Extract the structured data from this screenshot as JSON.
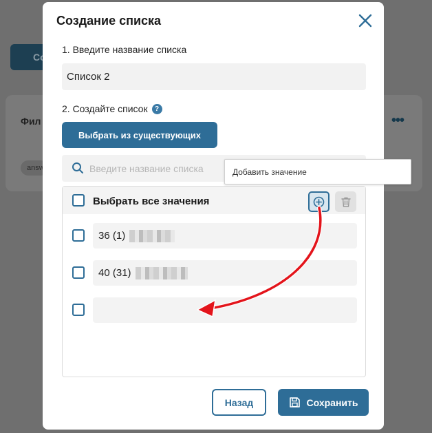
{
  "background": {
    "button_label": "Co",
    "card_title": "Фил",
    "chip_label": "answ",
    "more_icon": "more-dots-icon"
  },
  "modal": {
    "title": "Создание списка",
    "step1_label": "1. Введите название списка",
    "list_name_value": "Список 2",
    "step2_label": "2. Создайте список",
    "help_glyph": "?",
    "choose_button": "Выбрать из существующих",
    "search_placeholder": "Введите название списка",
    "select_all_label": "Выбрать все значения",
    "tooltip": "Добавить значение",
    "values": [
      {
        "text": "36 (1)"
      },
      {
        "text": "40 (31)"
      },
      {
        "text": ""
      }
    ],
    "back_button": "Назад",
    "save_button": "Сохранить"
  },
  "colors": {
    "accent": "#2e6d97",
    "annotation_arrow": "#e3141b"
  }
}
